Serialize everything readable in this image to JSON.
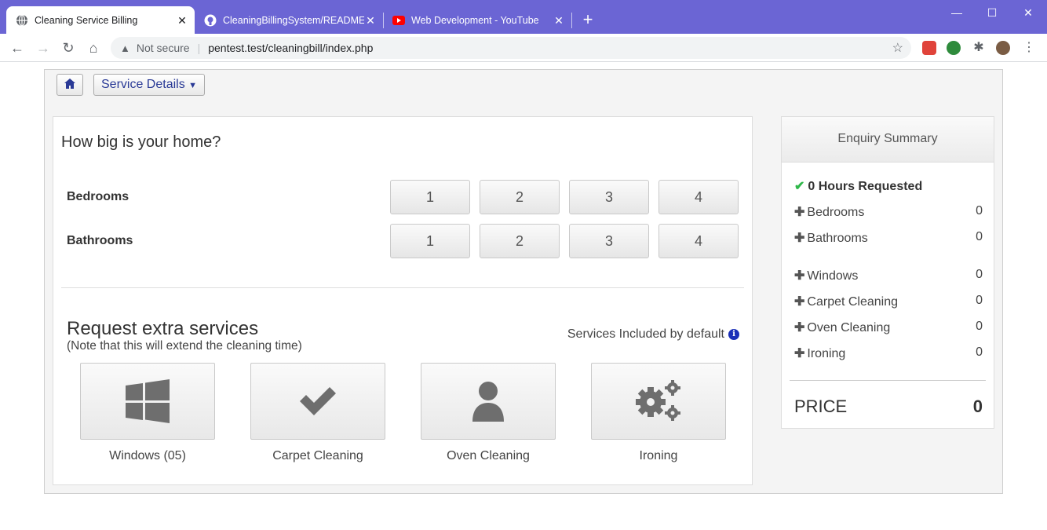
{
  "browser": {
    "tabs": [
      {
        "title": "Cleaning Service Billing",
        "active": true
      },
      {
        "title": "CleaningBillingSystem/README.md",
        "active": false
      },
      {
        "title": "Web Development - YouTube",
        "active": false
      }
    ],
    "new_tab": "+",
    "security_label": "Not secure",
    "url": "pentest.test/cleaningbill/index.php"
  },
  "nav": {
    "service_details_label": "Service Details"
  },
  "home_size": {
    "title": "How big is your home?",
    "bedrooms_label": "Bedrooms",
    "bathrooms_label": "Bathrooms",
    "options": [
      "1",
      "2",
      "3",
      "4"
    ]
  },
  "extras": {
    "title": "Request extra services",
    "note": "(Note that this will extend the cleaning time)",
    "included_label": "Services Included by default",
    "services": [
      {
        "label": "Windows (05)",
        "icon": "windows-icon"
      },
      {
        "label": "Carpet Cleaning",
        "icon": "check-icon"
      },
      {
        "label": "Oven Cleaning",
        "icon": "user-icon"
      },
      {
        "label": "Ironing",
        "icon": "gears-icon"
      }
    ]
  },
  "summary": {
    "title": "Enquiry Summary",
    "hours_label": "0 Hours Requested",
    "rows": [
      {
        "label": "Bedrooms",
        "value": "0"
      },
      {
        "label": "Bathrooms",
        "value": "0"
      },
      {
        "label": "Windows",
        "value": "0"
      },
      {
        "label": "Carpet Cleaning",
        "value": "0"
      },
      {
        "label": "Oven Cleaning",
        "value": "0"
      },
      {
        "label": "Ironing",
        "value": "0"
      }
    ],
    "price_label": "PRICE",
    "price_value": "0"
  },
  "colors": {
    "accent": "#2a3a96",
    "chrome": "#6b65d4",
    "check": "#2fb84a"
  }
}
